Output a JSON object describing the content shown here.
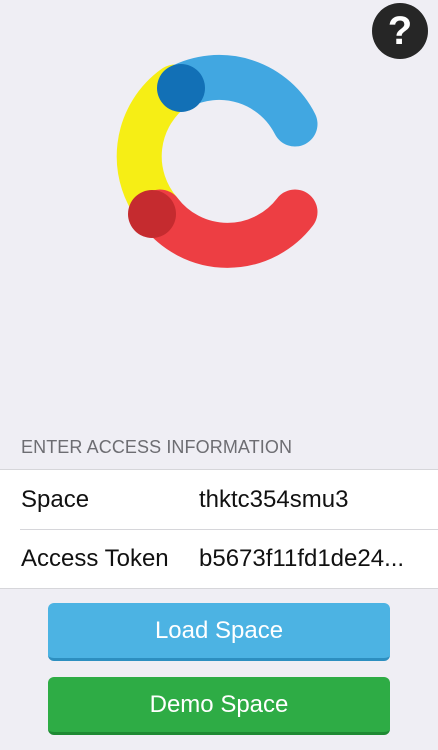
{
  "help": {
    "glyph": "?"
  },
  "logo": {
    "icon": "contentful-logo",
    "colors": {
      "blue": "#41a7e1",
      "dark_blue": "#1270b6",
      "yellow": "#f6ee15",
      "red": "#ed3e43",
      "dark_red": "#c52b2f"
    }
  },
  "form": {
    "section_header": "ENTER ACCESS INFORMATION",
    "space_label": "Space",
    "space_value": "thktc354smu3",
    "token_label": "Access Token",
    "token_value": "b5673f11fd1de24..."
  },
  "buttons": {
    "load_label": "Load Space",
    "demo_label": "Demo Space"
  },
  "colors": {
    "background": "#efeef4",
    "load_button": "#4cb3e3",
    "demo_button": "#2eac45"
  }
}
